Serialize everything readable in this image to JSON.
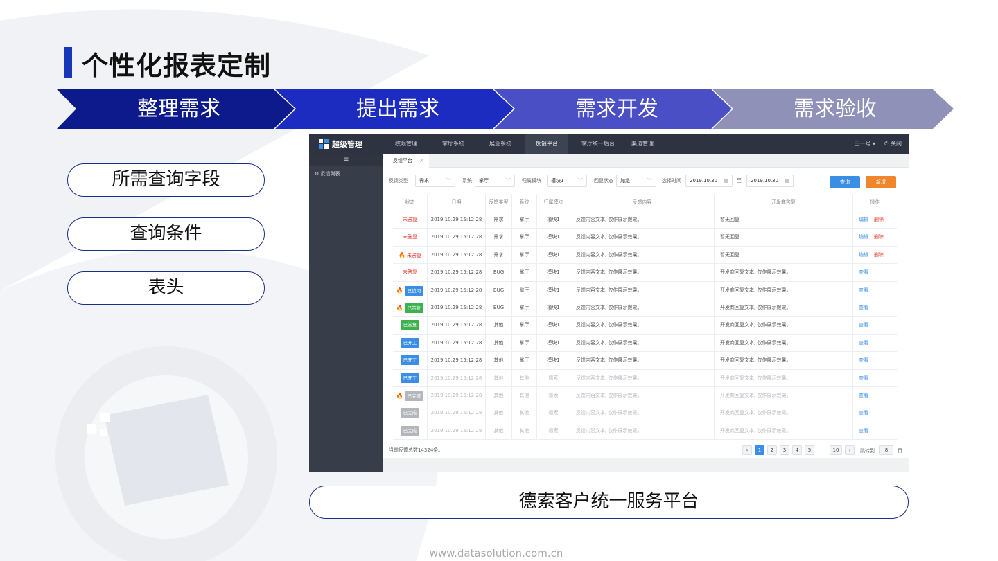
{
  "slide": {
    "title": "个性化报表定制",
    "footer_url": "www.datasolution.com.cn",
    "accent_color": "#1638b8"
  },
  "process_steps": [
    {
      "label": "整理需求",
      "color": "#0d1a8c"
    },
    {
      "label": "提出需求",
      "color": "#1c2cc0"
    },
    {
      "label": "需求开发",
      "color": "#4a4fc6"
    },
    {
      "label": "需求验收",
      "color": "#9091b8"
    }
  ],
  "pills": [
    "所需查询字段",
    "查询条件",
    "表头"
  ],
  "platform_label": "德索客户统一服务平台",
  "app": {
    "brand": "超级管理",
    "nav": [
      "权限管理",
      "掌厅系统",
      "展业系统",
      "反馈平台",
      "掌厅统一后台",
      "渠道管理"
    ],
    "active_nav": "反馈平台",
    "user": "王一号 ▾",
    "close": "⏻ 关闭",
    "side_toggle": "≡",
    "side_item": "⚙ 反馈列表",
    "tab": "反馈平台",
    "tab_close": "×",
    "filters": {
      "type_label": "反馈类型",
      "type_value": "需求",
      "system_label": "系统",
      "system_value": "掌厅",
      "module_label": "归属模块",
      "module_value": "模块1",
      "reply_label": "回复状态",
      "reply_value": "加急",
      "time_label": "选择时间",
      "time_from": "2019.10.30",
      "to_label": "至",
      "time_to": "2019.10.30",
      "query_button": "查询",
      "add_button": "新增"
    },
    "table": {
      "headers": [
        "状态",
        "日期",
        "反馈类型",
        "系统",
        "归属模块",
        "反馈内容",
        "开发商答复",
        "操作"
      ],
      "rows": [
        {
          "flame": false,
          "status": "未答复",
          "style": "red",
          "date": "2019.10.29 15:12:28",
          "type": "需求",
          "system": "掌厅",
          "module": "模块1",
          "content": "反馈内容文本, 仅作展示效果。",
          "reply": "暂无回复",
          "ops": [
            "编辑",
            "删除"
          ],
          "muted": false
        },
        {
          "flame": false,
          "status": "未答复",
          "style": "red",
          "date": "2019.10.29 15:12:28",
          "type": "需求",
          "system": "掌厅",
          "module": "模块1",
          "content": "反馈内容文本, 仅作展示效果。",
          "reply": "暂无回复",
          "ops": [
            "编辑",
            "删除"
          ],
          "muted": false
        },
        {
          "flame": true,
          "status": "未答复",
          "style": "red",
          "date": "2019.10.29 15:12:28",
          "type": "需求",
          "system": "掌厅",
          "module": "模块1",
          "content": "反馈内容文本, 仅作展示效果。",
          "reply": "暂无回复",
          "ops": [
            "编辑",
            "删除"
          ],
          "muted": false
        },
        {
          "flame": false,
          "status": "未答复",
          "style": "red",
          "date": "2019.10.29 15:12:28",
          "type": "BUG",
          "system": "掌厅",
          "module": "模块1",
          "content": "反馈内容文本, 仅作展示效果。",
          "reply": "开发商回复文本, 仅作展示效果。",
          "ops": [
            "查看"
          ],
          "muted": false
        },
        {
          "flame": true,
          "status": "已追问",
          "style": "blue",
          "date": "2019.10.29 15:12:28",
          "type": "BUG",
          "system": "掌厅",
          "module": "模块1",
          "content": "反馈内容文本, 仅作展示效果。",
          "reply": "开发商回复文本, 仅作展示效果。",
          "ops": [
            "查看"
          ],
          "muted": false
        },
        {
          "flame": true,
          "status": "已答复",
          "style": "green",
          "date": "2019.10.29 15:12:28",
          "type": "BUG",
          "system": "掌厅",
          "module": "模块1",
          "content": "反馈内容文本, 仅作展示效果。",
          "reply": "开发商回复文本, 仅作展示效果。",
          "ops": [
            "查看"
          ],
          "muted": false
        },
        {
          "flame": false,
          "status": "已答复",
          "style": "green",
          "date": "2019.10.29 15:12:28",
          "type": "其他",
          "system": "掌厅",
          "module": "模块1",
          "content": "反馈内容文本, 仅作展示效果。",
          "reply": "开发商回复文本, 仅作展示效果。",
          "ops": [
            "查看"
          ],
          "muted": false
        },
        {
          "flame": false,
          "status": "已开工",
          "style": "blue",
          "date": "2019.10.29 15:12:28",
          "type": "其他",
          "system": "掌厅",
          "module": "模块1",
          "content": "反馈内容文本, 仅作展示效果。",
          "reply": "开发商回复文本, 仅作展示效果。",
          "ops": [
            "查看"
          ],
          "muted": false
        },
        {
          "flame": false,
          "status": "已开工",
          "style": "blue",
          "date": "2019.10.29 15:12:28",
          "type": "其他",
          "system": "掌厅",
          "module": "模块1",
          "content": "反馈内容文本, 仅作展示效果。",
          "reply": "开发商回复文本, 仅作展示效果。",
          "ops": [
            "查看"
          ],
          "muted": false
        },
        {
          "flame": false,
          "status": "已开工",
          "style": "blue",
          "date": "2019.10.29 15:12:28",
          "type": "其他",
          "system": "其他",
          "module": "德索",
          "content": "反馈内容文本, 仅作展示效果。",
          "reply": "开发商回复文本, 仅作展示效果。",
          "ops": [
            "查看"
          ],
          "muted": true
        },
        {
          "flame": true,
          "status": "已完成",
          "style": "gray",
          "date": "2019.10.29 15:12:28",
          "type": "其他",
          "system": "其他",
          "module": "德索",
          "content": "反馈内容文本, 仅作展示效果。",
          "reply": "开发商回复文本, 仅作展示效果。",
          "ops": [
            "查看"
          ],
          "muted": true
        },
        {
          "flame": false,
          "status": "已完成",
          "style": "gray",
          "date": "2019.10.29 15:12:28",
          "type": "其他",
          "system": "其他",
          "module": "德索",
          "content": "反馈内容文本, 仅作展示效果。",
          "reply": "开发商回复文本, 仅作展示效果。",
          "ops": [
            "查看"
          ],
          "muted": true
        },
        {
          "flame": false,
          "status": "已完成",
          "style": "gray",
          "date": "2019.10.29 15:12:28",
          "type": "其他",
          "system": "其他",
          "module": "德索",
          "content": "反馈内容文本, 仅作展示效果。",
          "reply": "开发商回复文本, 仅作展示效果。",
          "ops": [
            "查看"
          ],
          "muted": true
        }
      ]
    },
    "footer": {
      "total": "当前反馈总数14324条。",
      "prev": "‹",
      "pages": [
        "1",
        "2",
        "3",
        "4",
        "5",
        "···",
        "10"
      ],
      "active_page": "1",
      "next": "›",
      "jump_label": "跳转到",
      "jump_value": "8",
      "page_suffix": "页"
    }
  }
}
